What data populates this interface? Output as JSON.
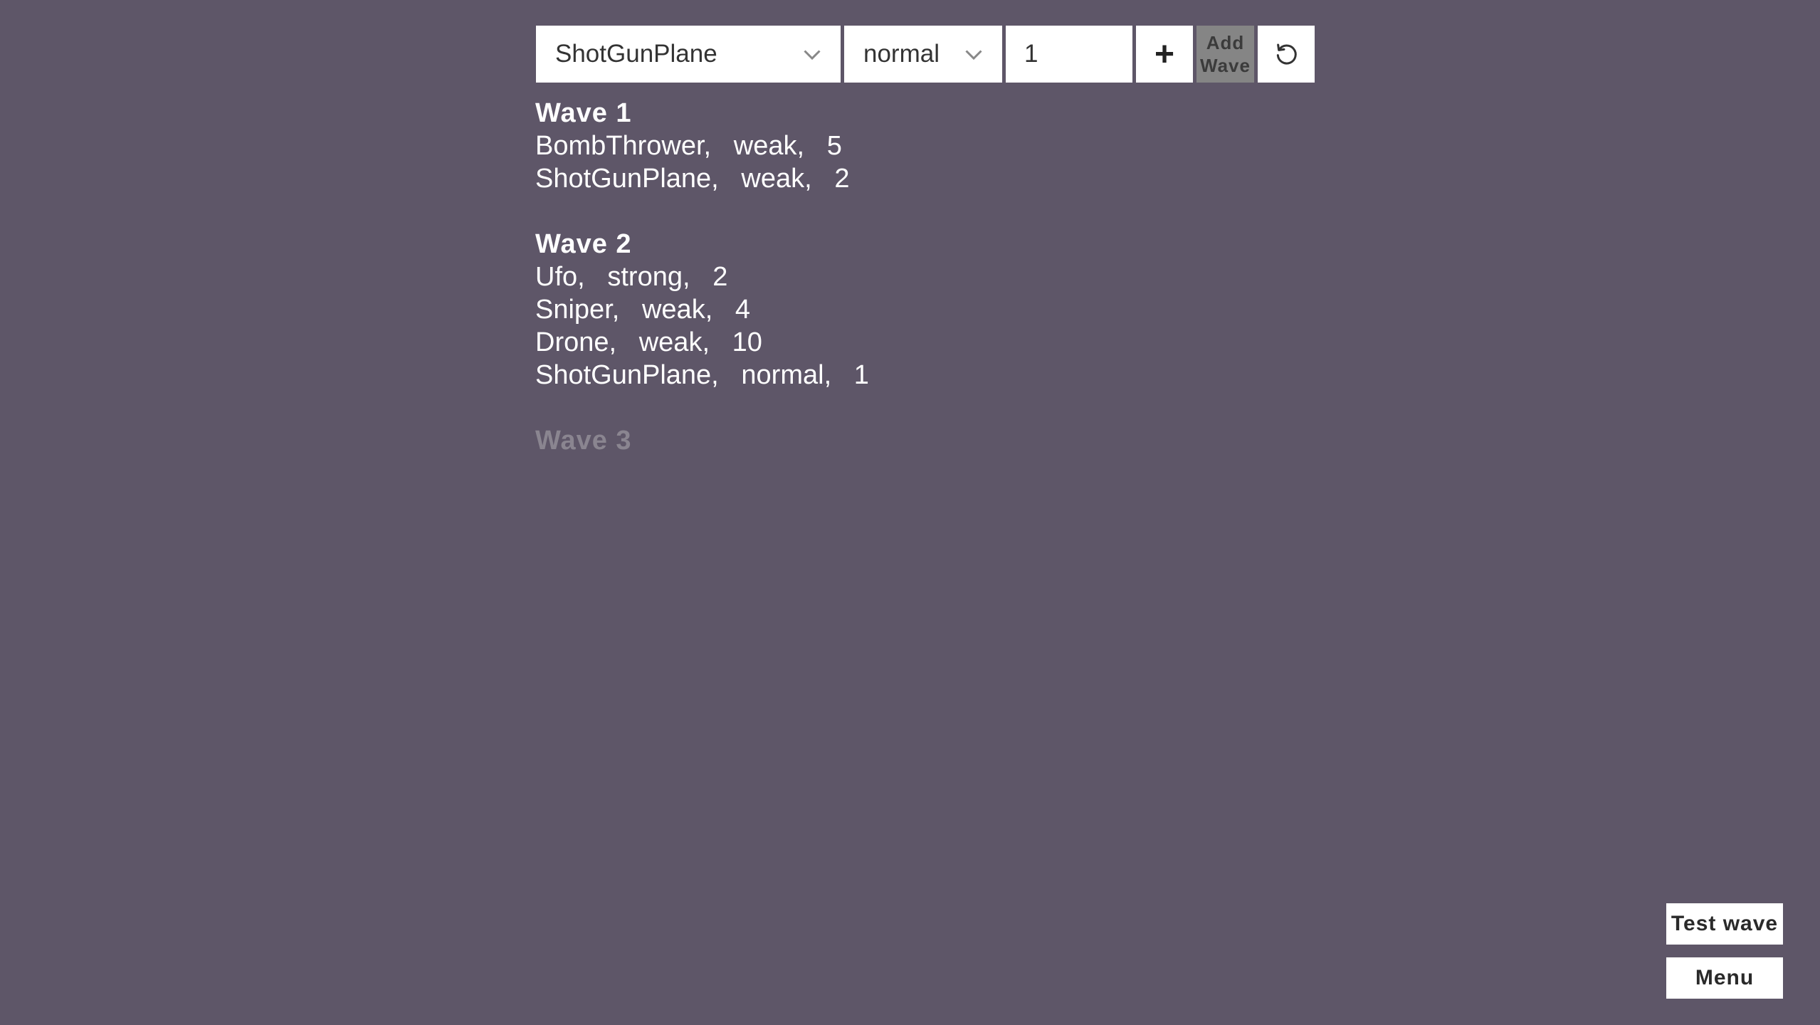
{
  "toolbar": {
    "enemy_select": {
      "selected": "ShotGunPlane",
      "icon": "chevron-down-icon"
    },
    "strength_select": {
      "selected": "normal",
      "icon": "chevron-down-icon"
    },
    "count_input": {
      "value": "1"
    },
    "add_button": {
      "label": "+"
    },
    "add_wave_button": {
      "label_line1": "Add",
      "label_line2": "Wave"
    },
    "reset_button": {
      "icon": "undo-icon"
    }
  },
  "waves": [
    {
      "title": "Wave 1",
      "entries": [
        {
          "text": "BombThrower,   weak,   5"
        },
        {
          "text": "ShotGunPlane,   weak,   2"
        }
      ]
    },
    {
      "title": "Wave 2",
      "entries": [
        {
          "text": "Ufo,   strong,   2"
        },
        {
          "text": "Sniper,   weak,   4"
        },
        {
          "text": "Drone,   weak,   10"
        },
        {
          "text": "ShotGunPlane,   normal,   1"
        }
      ]
    },
    {
      "title": "Wave 3",
      "entries": []
    }
  ],
  "side_buttons": {
    "test_wave": "Test wave",
    "menu": "Menu"
  },
  "colors": {
    "background": "#5e5668",
    "control_bg": "#ffffff",
    "add_wave_bg": "#858585",
    "inactive_wave": "#8a8590"
  }
}
